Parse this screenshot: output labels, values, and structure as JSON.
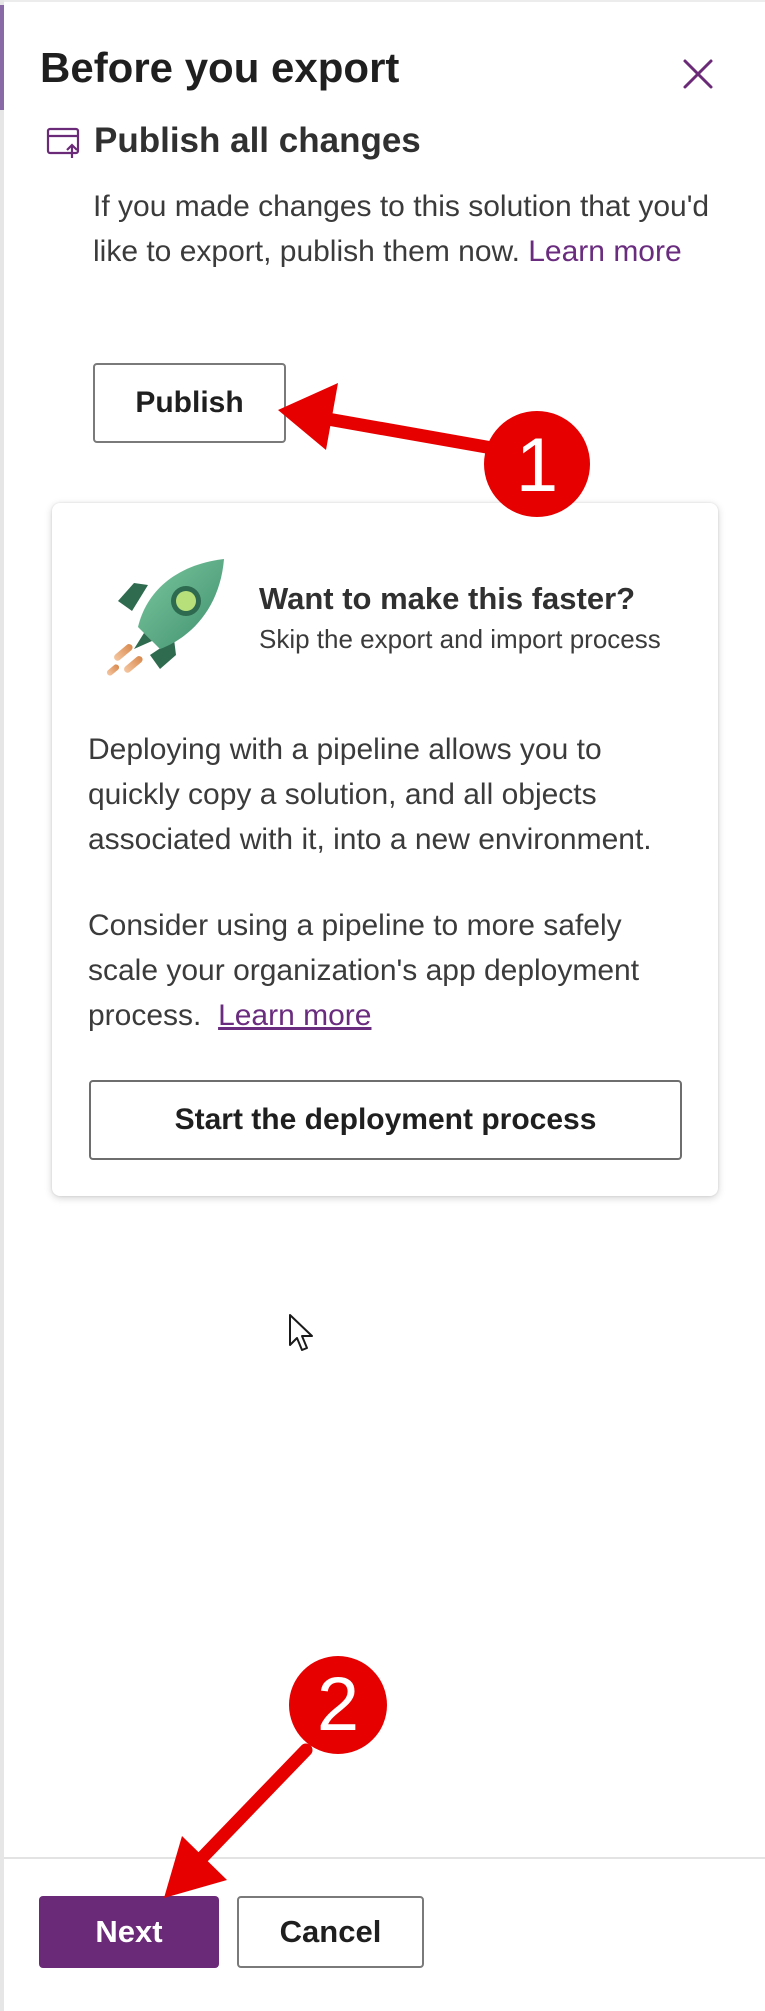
{
  "panel": {
    "title": "Before you export",
    "close_icon": "close-icon"
  },
  "publish_section": {
    "icon": "publish-window-icon",
    "title": "Publish all changes",
    "description": "If you made changes to this solution that you'd like to export, publish them now.",
    "learn_more": "Learn more",
    "publish_button": "Publish"
  },
  "pipeline_card": {
    "icon": "rocket-icon",
    "heading": "Want to make this faster?",
    "subheading": "Skip the export and import process",
    "paragraph1": "Deploying with a pipeline allows you to quickly copy a solution, and all objects associated with it, into a new environment.",
    "paragraph2": "Consider using a pipeline to more safely scale your organization's app deployment process.",
    "learn_more": "Learn more",
    "deploy_button": "Start the deployment process"
  },
  "footer": {
    "next_button": "Next",
    "cancel_button": "Cancel"
  },
  "annotations": {
    "step1": "1",
    "step2": "2",
    "marker_color": "#e60000"
  },
  "colors": {
    "accent": "#6b2a78",
    "link": "#6a2c7e"
  }
}
